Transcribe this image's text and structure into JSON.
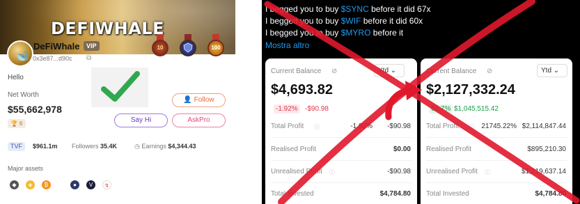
{
  "profile": {
    "brand_logo": "DEFIWHALE",
    "name": "DeFiWhale",
    "vip_badge": "VIP",
    "address": "0x3e87...d90c",
    "badges": [
      "10",
      "",
      "100"
    ],
    "greeting": "Hello",
    "net_worth_label": "Net Worth",
    "net_worth_value": "$55,662,978",
    "rank": "6",
    "tvf_label": "TVF",
    "tvf_value": "$961.1m",
    "followers_label": "Followers",
    "followers_value": "35.4K",
    "earnings_label": "Earnings",
    "earnings_value": "$4,344.43",
    "major_assets_label": "Major assets",
    "buttons": {
      "follow": "Follow",
      "say_hi": "Say Hi",
      "ask_pro": "AskPro"
    },
    "approval_icon": "green-checkmark-icon"
  },
  "tweet": {
    "lines": [
      {
        "prefix": "I begged you to buy ",
        "tag": "$SYNC",
        "suffix": " before it did 67x"
      },
      {
        "prefix": "I begged you to buy ",
        "tag": "$WIF",
        "suffix": " before it did 60x"
      },
      {
        "prefix": "I begged you to buy ",
        "tag": "$MYRO",
        "suffix": " before it"
      }
    ],
    "show_more": "Mostra altro"
  },
  "portfolio_before": {
    "balance_label": "Current Balance",
    "period": "Ytd",
    "balance": "$4,693.82",
    "change_pct": "-1.92%",
    "change_abs": "-$90.98",
    "total_profit_label": "Total Profit",
    "total_profit_pct": "-1.92%",
    "total_profit_abs": "-$90.98",
    "realised_label": "Realised Profit",
    "realised_value": "$0.00",
    "unrealised_label": "Unrealised Profit",
    "unrealised_value": "-$90.98",
    "invested_label": "Total Invested",
    "invested_value": "$4,784.80"
  },
  "portfolio_after": {
    "balance_label": "Current Balance",
    "period": "Ytd",
    "balance": "$2,127,332.24",
    "change_pct": "62.7%",
    "change_abs": "$1,045,515.42",
    "total_profit_label": "Total Profit",
    "total_profit_pct": "21745.22%",
    "total_profit_abs": "$2,114,847.44",
    "realised_label": "Realised Profit",
    "realised_value": "$895,210.30",
    "unrealised_label": "Unrealised Profit",
    "unrealised_value": "$1,219,637.14",
    "invested_label": "Total Invested",
    "invested_value": "$4,784.80"
  },
  "colors": {
    "cross_red": "#e0182c",
    "check_green": "#2fa84f",
    "link_blue": "#1d9bf0",
    "negative": "#e0384a",
    "positive": "#1b9a4a"
  }
}
